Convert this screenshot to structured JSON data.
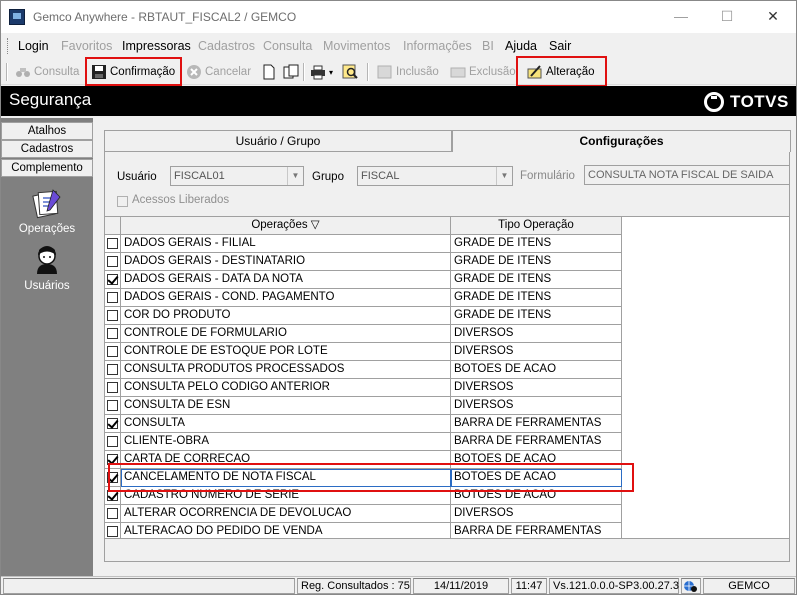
{
  "window": {
    "title": "Gemco Anywhere - RBTAUT_FISCAL2 / GEMCO",
    "min_glyph": "—",
    "max_glyph": "☐",
    "close_glyph": "✕"
  },
  "menu": {
    "items": [
      {
        "label": "Login",
        "enabled": true
      },
      {
        "label": "Favoritos",
        "enabled": false
      },
      {
        "label": "Impressoras",
        "enabled": true
      },
      {
        "label": "Cadastros",
        "enabled": false
      },
      {
        "label": "Consulta",
        "enabled": false
      },
      {
        "label": "Movimentos",
        "enabled": false
      },
      {
        "label": "Informações",
        "enabled": false
      },
      {
        "label": "BI",
        "enabled": false
      },
      {
        "label": "Ajuda",
        "enabled": true
      },
      {
        "label": "Sair",
        "enabled": true
      }
    ]
  },
  "toolbar": {
    "consulta": "Consulta",
    "confirmacao": "Confirmação",
    "cancelar": "Cancelar",
    "inclusao": "Inclusão",
    "exclusao": "Exclusão",
    "alteracao": "Alteração"
  },
  "header": {
    "title": "Segurança",
    "brand": "TOTVS"
  },
  "sidebar": {
    "tabs": [
      "Atalhos",
      "Cadastros",
      "Complemento"
    ],
    "items": [
      {
        "label": "Operações",
        "icon": "documents-icon"
      },
      {
        "label": "Usuários",
        "icon": "user-icon"
      }
    ]
  },
  "tabs": {
    "user_group": "Usuário  / Grupo",
    "config": "Configurações"
  },
  "form": {
    "usuario_label": "Usuário",
    "usuario_value": "FISCAL01",
    "grupo_label": "Grupo",
    "grupo_value": "FISCAL",
    "formulario_label": "Formulário",
    "formulario_value": "CONSULTA NOTA FISCAL DE SAIDA",
    "acessos_label": "Acessos Liberados"
  },
  "grid": {
    "columns": {
      "operacoes": "Operações  ▽",
      "tipo": "Tipo Operação"
    },
    "rows": [
      {
        "checked": false,
        "op": "DADOS GERAIS - FILIAL",
        "tipo": "GRADE DE ITENS"
      },
      {
        "checked": false,
        "op": "DADOS GERAIS - DESTINATARIO",
        "tipo": "GRADE DE ITENS"
      },
      {
        "checked": true,
        "op": "DADOS GERAIS - DATA DA NOTA",
        "tipo": "GRADE DE ITENS"
      },
      {
        "checked": false,
        "op": "DADOS GERAIS - COND. PAGAMENTO",
        "tipo": "GRADE DE ITENS"
      },
      {
        "checked": false,
        "op": "COR DO PRODUTO",
        "tipo": "GRADE DE ITENS"
      },
      {
        "checked": false,
        "op": "CONTROLE DE FORMULARIO",
        "tipo": "DIVERSOS"
      },
      {
        "checked": false,
        "op": "CONTROLE DE ESTOQUE POR LOTE",
        "tipo": "DIVERSOS"
      },
      {
        "checked": false,
        "op": "CONSULTA PRODUTOS PROCESSADOS",
        "tipo": "BOTOES DE ACAO"
      },
      {
        "checked": false,
        "op": "CONSULTA PELO CODIGO ANTERIOR",
        "tipo": "DIVERSOS"
      },
      {
        "checked": false,
        "op": "CONSULTA DE ESN",
        "tipo": "DIVERSOS"
      },
      {
        "checked": true,
        "op": "CONSULTA",
        "tipo": "BARRA DE FERRAMENTAS"
      },
      {
        "checked": false,
        "op": "CLIENTE-OBRA",
        "tipo": "BARRA DE FERRAMENTAS"
      },
      {
        "checked": true,
        "op": "CARTA DE CORRECAO",
        "tipo": "BOTOES DE ACAO"
      },
      {
        "checked": true,
        "op": "CANCELAMENTO DE NOTA FISCAL",
        "tipo": "BOTOES DE ACAO",
        "selected": true
      },
      {
        "checked": true,
        "op": "CADASTRO NUMERO DE SERIE",
        "tipo": "BOTOES DE ACAO"
      },
      {
        "checked": false,
        "op": "ALTERAR OCORRENCIA DE DEVOLUCAO",
        "tipo": "DIVERSOS"
      },
      {
        "checked": false,
        "op": "ALTERACAO DO PEDIDO DE VENDA",
        "tipo": "BARRA DE FERRAMENTAS"
      }
    ]
  },
  "status": {
    "reg": "Reg. Consultados : 75",
    "date": "14/11/2019",
    "time": "11:47",
    "version": "Vs.121.0.0.0-SP3.00.27.3",
    "company": "GEMCO"
  },
  "colors": {
    "highlight_box": "#e01010",
    "header_bg": "#000000",
    "sidebar_bg": "#808080"
  }
}
